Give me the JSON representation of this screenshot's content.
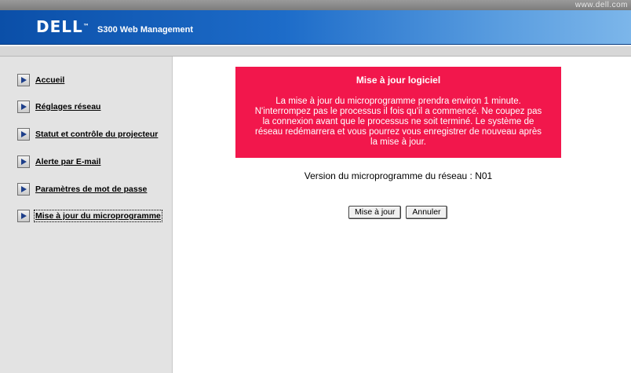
{
  "header": {
    "url_text": "www.dell.com",
    "logo_text": "DELL",
    "product_title": "S300 Web Management"
  },
  "sidebar": {
    "items": [
      {
        "label": "Accueil"
      },
      {
        "label": "Réglages réseau"
      },
      {
        "label": "Statut et contrôle du projecteur"
      },
      {
        "label": "Alerte par E-mail"
      },
      {
        "label": "Paramètres de mot de passe"
      },
      {
        "label": "Mise à jour du microprogramme"
      }
    ]
  },
  "notice": {
    "title": "Mise à jour logiciel",
    "body": "La mise à jour du microprogramme prendra environ 1 minute. N'interrompez pas le processus il fois qu'il a commencé. Ne coupez pas la connexion avant que le processus ne soit terminé. Le système de réseau redémarrera et vous pourrez vous enregistrer de nouveau après la mise à jour."
  },
  "firmware": {
    "version_text": "Version du microprogramme du réseau : N01"
  },
  "actions": {
    "update_label": "Mise à jour",
    "cancel_label": "Annuler"
  },
  "colors": {
    "banner": "#1d6cc9",
    "notice_bg": "#f2174c",
    "sidebar_bg": "#e3e3e3"
  }
}
